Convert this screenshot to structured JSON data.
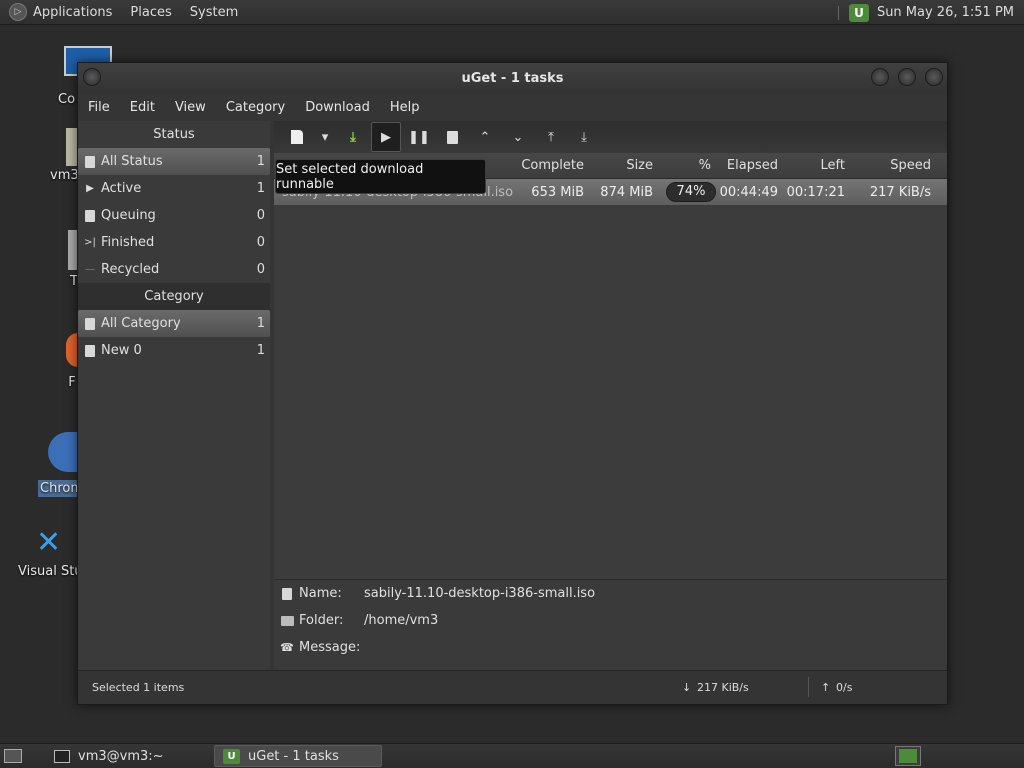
{
  "top_panel": {
    "menu": [
      "Applications",
      "Places",
      "System"
    ],
    "clock": "Sun May 26,  1:51 PM"
  },
  "desktop": {
    "icons": [
      {
        "label": "Co"
      },
      {
        "label": "vm3"
      },
      {
        "label": "T"
      },
      {
        "label": "F"
      },
      {
        "label": "Chrom"
      },
      {
        "label": "Visual Stu"
      }
    ]
  },
  "window": {
    "title": "uGet - 1 tasks",
    "menubar": [
      "File",
      "Edit",
      "View",
      "Category",
      "Download",
      "Help"
    ],
    "status": {
      "header": "Status",
      "items": [
        {
          "label": "All Status",
          "count": "1"
        },
        {
          "label": "Active",
          "count": "1"
        },
        {
          "label": "Queuing",
          "count": "0"
        },
        {
          "label": "Finished",
          "count": "0"
        },
        {
          "label": "Recycled",
          "count": "0"
        }
      ]
    },
    "category": {
      "header": "Category",
      "items": [
        {
          "label": "All Category",
          "count": "1"
        },
        {
          "label": "New 0",
          "count": "1"
        }
      ]
    },
    "tooltip": "Set selected download runnable",
    "columns": [
      "Complete",
      "Size",
      "%",
      "Elapsed",
      "Left",
      "Speed"
    ],
    "task": {
      "name": "sabily-11.10-desktop-i386-small.iso",
      "complete": "653 MiB",
      "size": "874 MiB",
      "percent": "74%",
      "progress": 0.74,
      "elapsed": "00:44:49",
      "left": "00:17:21",
      "speed": "217 KiB/s"
    },
    "details": {
      "name_label": "Name:",
      "name_value": "sabily-11.10-desktop-i386-small.iso",
      "folder_label": "Folder:",
      "folder_value": "/home/vm3",
      "message_label": "Message:"
    },
    "statusbar": {
      "selected": "Selected 1 items",
      "down_speed": "217 KiB/s",
      "up_speed": "0/s"
    }
  },
  "taskbar": {
    "items": [
      {
        "label": "vm3@vm3:~"
      },
      {
        "label": "uGet - 1 tasks"
      }
    ]
  },
  "colors": {
    "accent_green": "#4d8a3a",
    "bg": "#2b2b2b"
  }
}
